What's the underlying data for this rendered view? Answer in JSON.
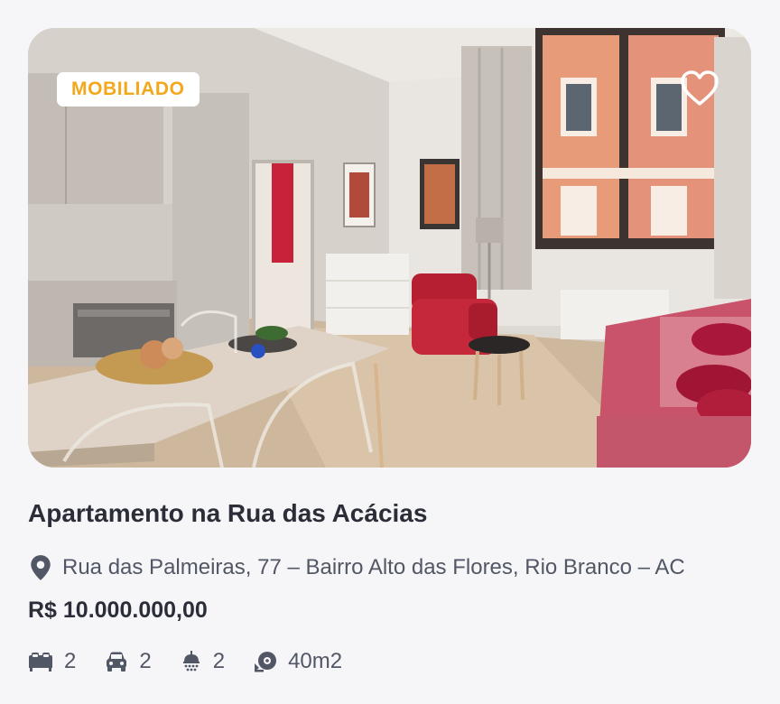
{
  "listing": {
    "badge": "MOBILIADO",
    "title": "Apartamento na Rua das Acácias",
    "address": "Rua das Palmeiras, 77 – Bairro Alto das Flores, Rio Branco – AC",
    "price": "R$ 10.000.000,00",
    "features": {
      "bedrooms": "2",
      "parking": "2",
      "bathrooms": "2",
      "area": "40m2"
    }
  },
  "icons": {
    "favorite": "heart-outline-icon",
    "location": "map-pin-icon",
    "bedrooms": "bed-icon",
    "parking": "car-icon",
    "bathrooms": "shower-icon",
    "area": "area-icon"
  },
  "colors": {
    "badge_text": "#f3a81b",
    "title_text": "#2b2e38",
    "secondary_text": "#525766",
    "background": "#f6f6f8"
  }
}
